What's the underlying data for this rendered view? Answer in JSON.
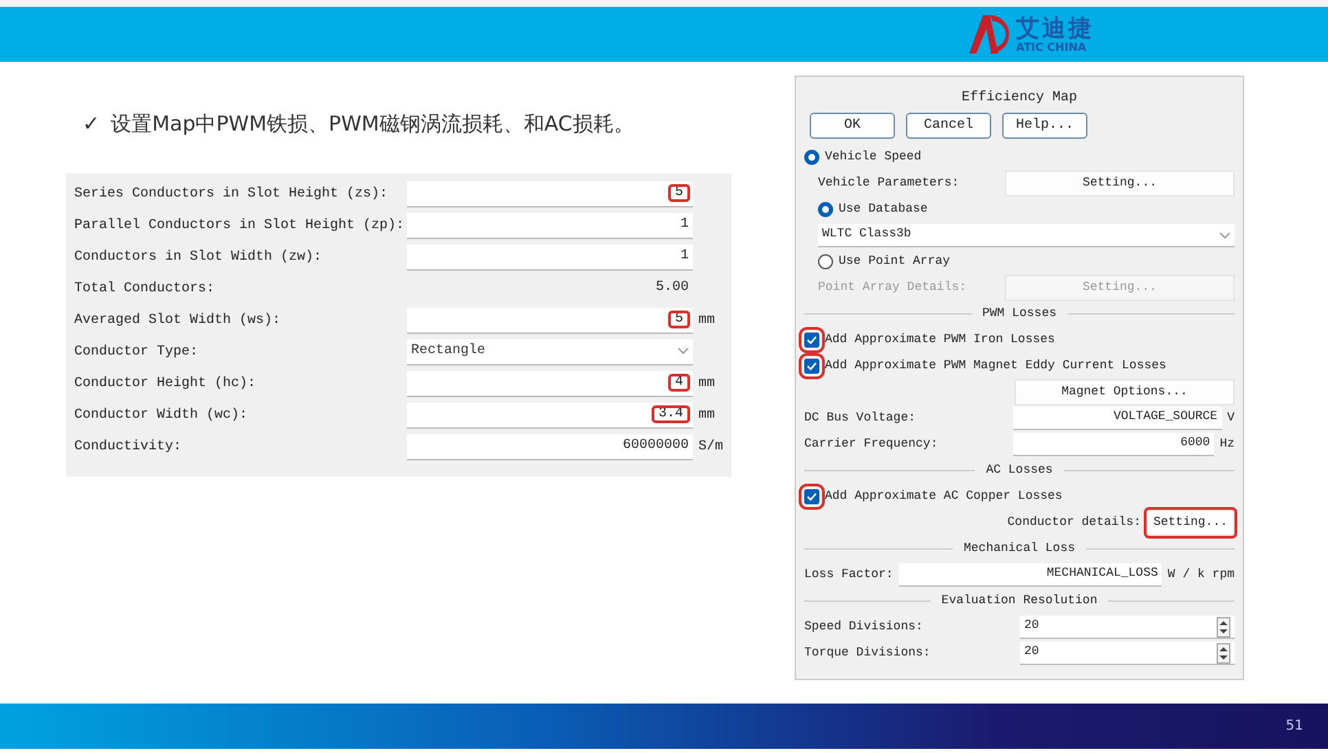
{
  "header": {
    "logo_cn": "艾迪捷",
    "logo_en": "ATIC CHINA"
  },
  "bullet": {
    "mark": "✓",
    "text": "设置Map中PWM铁损、PWM磁钢涡流损耗、和AC损耗。"
  },
  "conductor_panel": {
    "rows": [
      {
        "kind": "input",
        "label": "Series Conductors in Slot Height (zs):",
        "value": "5",
        "highlighted": true
      },
      {
        "kind": "input",
        "label": "Parallel Conductors in Slot Height (zp):",
        "value": "1",
        "highlighted": false
      },
      {
        "kind": "input",
        "label": "Conductors in Slot Width (zw):",
        "value": "1",
        "highlighted": false
      },
      {
        "kind": "readout",
        "label": "Total Conductors:",
        "value": "5.00",
        "highlighted": false
      },
      {
        "kind": "input",
        "label": "Averaged Slot Width (ws):",
        "value": "5",
        "unit": "mm",
        "highlighted": true
      },
      {
        "kind": "select",
        "label": "Conductor Type:",
        "value": "Rectangle",
        "highlighted": false
      },
      {
        "kind": "input",
        "label": "Conductor Height (hc):",
        "value": "4",
        "unit": "mm",
        "highlighted": true
      },
      {
        "kind": "input",
        "label": "Conductor Width (wc):",
        "value": "3.4",
        "unit": "mm",
        "highlighted": true
      },
      {
        "kind": "input",
        "label": "Conductivity:",
        "value": "60000000",
        "unit": "S/m",
        "highlighted": false
      }
    ]
  },
  "dialog": {
    "title": "Efficiency Map",
    "buttons": [
      "OK",
      "Cancel",
      "Help..."
    ],
    "items": [
      {
        "kind": "radio",
        "label": "Vehicle Speed",
        "selected": true,
        "children": [
          {
            "kind": "button_row",
            "label": "Vehicle Parameters:",
            "button": "Setting...",
            "disabled": false
          },
          {
            "kind": "radio",
            "label": "Use Database",
            "selected": true
          },
          {
            "kind": "select",
            "value": "WLTC Class3b"
          },
          {
            "kind": "radio",
            "label": "Use Point Array",
            "selected": false
          },
          {
            "kind": "button_row",
            "label": "Point Array Details:",
            "button": "Setting...",
            "disabled": true
          }
        ]
      },
      {
        "kind": "separator",
        "label": "PWM Losses"
      },
      {
        "kind": "checkbox",
        "label": "Add Approximate PWM Iron Losses",
        "checked": true,
        "highlighted": true
      },
      {
        "kind": "checkbox",
        "label": "Add Approximate PWM Magnet Eddy Current Losses",
        "checked": true,
        "highlighted": true
      },
      {
        "kind": "button",
        "label": "Magnet Options...",
        "highlighted": false
      },
      {
        "kind": "input",
        "label": "DC Bus Voltage:",
        "value": "VOLTAGE_SOURCE",
        "unit": "V"
      },
      {
        "kind": "input",
        "label": "Carrier Frequency:",
        "value": "6000",
        "unit": "Hz"
      },
      {
        "kind": "separator",
        "label": "AC Losses"
      },
      {
        "kind": "checkbox",
        "label": "Add Approximate AC Copper Losses",
        "checked": true,
        "highlighted": true
      },
      {
        "kind": "label_button",
        "label": "Conductor details:",
        "button": "Setting...",
        "highlighted": true
      },
      {
        "kind": "separator",
        "label": "Mechanical Loss"
      },
      {
        "kind": "input_inline",
        "label": "Loss Factor:",
        "value": "MECHANICAL_LOSS",
        "unit": "W / k rpm"
      },
      {
        "kind": "separator",
        "label": "Evaluation Resolution"
      },
      {
        "kind": "spin",
        "label": "Speed Divisions:",
        "value": "20"
      },
      {
        "kind": "spin",
        "label": "Torque Divisions:",
        "value": "20"
      }
    ]
  },
  "page_number": "51"
}
